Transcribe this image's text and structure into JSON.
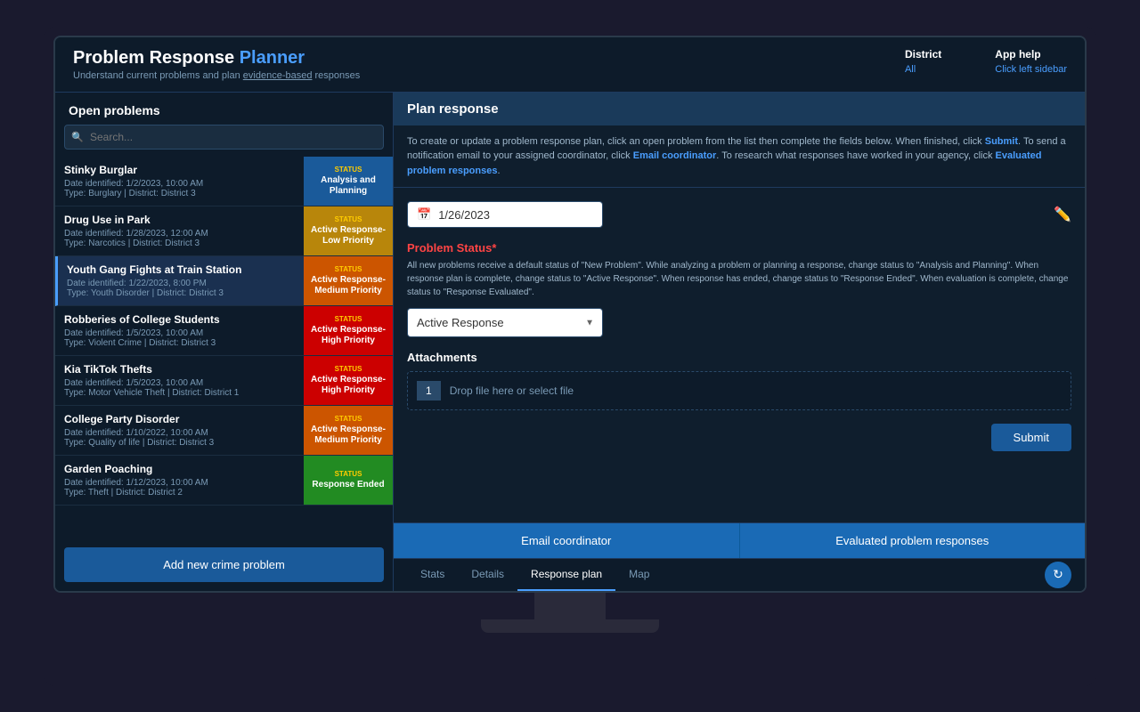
{
  "app": {
    "title": "Problem Response Planner",
    "subtitle": "Understand current problems and plan evidence-based responses"
  },
  "header": {
    "district_label": "District",
    "district_value": "All",
    "help_label": "App help",
    "help_value": "Click left sidebar"
  },
  "left_panel": {
    "title": "Open problems",
    "search_placeholder": "Search...",
    "problems": [
      {
        "name": "Stinky Burglar",
        "date": "Date identified: 1/2/2023, 10:00 AM",
        "type": "Type: Burglary | District: District 3",
        "status_label": "Status",
        "status_value": "Analysis and Planning",
        "badge_class": "badge-blue"
      },
      {
        "name": "Drug Use in Park",
        "date": "Date identified: 1/28/2023, 12:00 AM",
        "type": "Type: Narcotics | District: District 3",
        "status_label": "Status",
        "status_value": "Active Response-Low Priority",
        "badge_class": "badge-yellow"
      },
      {
        "name": "Youth Gang Fights at Train Station",
        "date": "Date identified: 1/22/2023, 8:00 PM",
        "type": "Type: Youth Disorder | District: District 3",
        "status_label": "Status",
        "status_value": "Active Response-Medium Priority",
        "badge_class": "badge-orange",
        "selected": true
      },
      {
        "name": "Robberies of College Students",
        "date": "Date identified: 1/5/2023, 10:00 AM",
        "type": "Type: Violent Crime | District: District 3",
        "status_label": "Status",
        "status_value": "Active Response-High Priority",
        "badge_class": "badge-red"
      },
      {
        "name": "Kia TikTok Thefts",
        "date": "Date identified: 1/5/2023, 10:00 AM",
        "type": "Type: Motor Vehicle Theft | District: District 1",
        "status_label": "Status",
        "status_value": "Active Response-High Priority",
        "badge_class": "badge-red"
      },
      {
        "name": "College Party Disorder",
        "date": "Date identified: 1/10/2022, 10:00 AM",
        "type": "Type: Quality of life | District: District 3",
        "status_label": "Status",
        "status_value": "Active Response-Medium Priority",
        "badge_class": "badge-orange"
      },
      {
        "name": "Garden Poaching",
        "date": "Date identified: 1/12/2023, 10:00 AM",
        "type": "Type: Theft | District: District 2",
        "status_label": "Status",
        "status_value": "Response Ended",
        "badge_class": "badge-green"
      }
    ],
    "add_button": "Add new crime problem"
  },
  "right_panel": {
    "title": "Plan response",
    "description_parts": [
      "To create or update a problem response plan, click an open problem from the list then complete the fields below. When finished, click ",
      "Submit",
      ". To send a notification email to your assigned coordinator, click ",
      "Email coordinator",
      ". To research what responses have worked in your agency, click ",
      "Evaluated problem responses",
      "."
    ],
    "date_value": "1/26/2023",
    "problem_status_label": "Problem Status",
    "problem_status_required": "*",
    "problem_status_desc": "All new problems receive a default status of \"New Problem\". While analyzing a problem or planning a response, change status to \"Analysis and Planning\". When response plan is complete, change status to \"Active Response\". When response has ended, change status to \"Response Ended\". When evaluation is complete, change status to \"Response Evaluated\".",
    "status_options": [
      "New Problem",
      "Analysis and Planning",
      "Active Response",
      "Response Ended",
      "Response Evaluated"
    ],
    "selected_status": "Active Response",
    "attachments_label": "Attachments",
    "drop_count": "1",
    "drop_text": "Drop file here or select file",
    "submit_label": "Submit",
    "email_coordinator": "Email coordinator",
    "evaluated_responses": "Evaluated problem responses"
  },
  "tabs": {
    "items": [
      "Stats",
      "Details",
      "Response plan",
      "Map"
    ],
    "active": "Response plan"
  }
}
